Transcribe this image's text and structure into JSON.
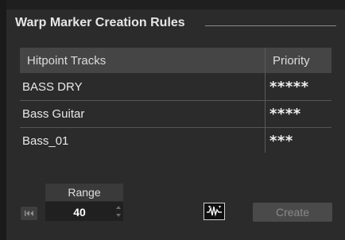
{
  "group": {
    "title": "Warp Marker Creation Rules"
  },
  "table": {
    "headers": {
      "tracks": "Hitpoint Tracks",
      "priority": "Priority"
    },
    "rows": [
      {
        "name": "BASS DRY",
        "priority": "*****"
      },
      {
        "name": "Bass Guitar",
        "priority": "****"
      },
      {
        "name": "Bass_01",
        "priority": "***"
      }
    ]
  },
  "range": {
    "label": "Range",
    "value": "40"
  },
  "icons": {
    "skip": "skip-to-start-icon",
    "warp": "warp-waveform-icon"
  },
  "buttons": {
    "create": "Create"
  },
  "colors": {
    "panel_bg": "#2b2b2b",
    "header_bg": "#454545",
    "create_text_disabled": "#8a8a8a"
  }
}
